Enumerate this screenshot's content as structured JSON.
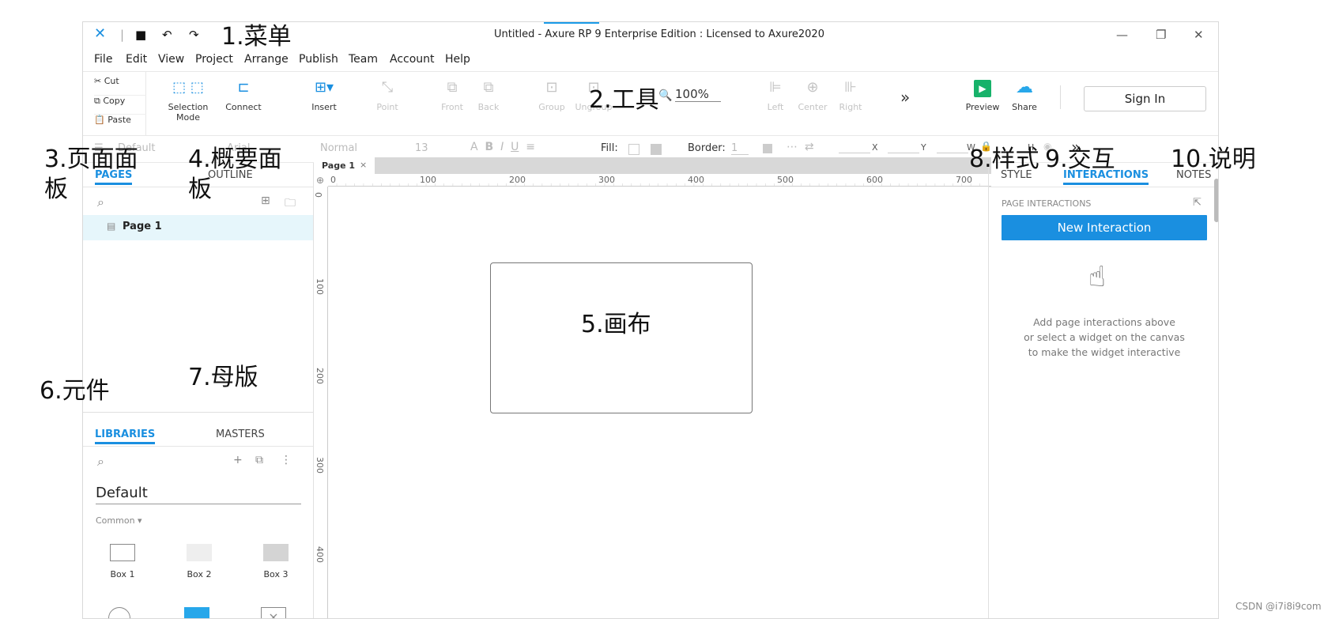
{
  "window": {
    "title": "Untitled - Axure RP 9 Enterprise Edition : Licensed to Axure2020"
  },
  "menu": [
    "File",
    "Edit",
    "View",
    "Project",
    "Arrange",
    "Publish",
    "Team",
    "Account",
    "Help"
  ],
  "clipboard": {
    "cut": "Cut",
    "copy": "Copy",
    "paste": "Paste"
  },
  "toolbar": {
    "selection_mode": "Selection Mode",
    "connect": "Connect",
    "insert": "Insert",
    "point": "Point",
    "front": "Front",
    "back": "Back",
    "group": "Group",
    "ungroup": "Ungroup",
    "zoom": "100%",
    "left": "Left",
    "center": "Center",
    "right": "Right",
    "preview": "Preview",
    "share": "Share",
    "sign_in": "Sign In"
  },
  "format": {
    "style": "Default",
    "font": "Arial",
    "weight": "Normal",
    "size": "13",
    "fill": "Fill:",
    "border": "Border:",
    "border_val": "1",
    "x": "X",
    "y": "Y",
    "w": "W",
    "h": "H"
  },
  "left_panel": {
    "tabs": {
      "pages": "PAGES",
      "outline": "OUTLINE"
    },
    "page_item": "Page 1",
    "lib_tabs": {
      "libraries": "LIBRARIES",
      "masters": "MASTERS"
    },
    "library_select": "Default",
    "group": "Common ▾",
    "items": [
      "Box 1",
      "Box 2",
      "Box 3"
    ]
  },
  "canvas": {
    "tab": "Page 1",
    "ruler_h": [
      "0",
      "100",
      "200",
      "300",
      "400",
      "500",
      "600",
      "700"
    ],
    "ruler_v": [
      "0",
      "100",
      "200",
      "300",
      "400"
    ]
  },
  "right_panel": {
    "tabs": {
      "style": "STYLE",
      "interactions": "INTERACTIONS",
      "notes": "NOTES"
    },
    "section": "PAGE INTERACTIONS",
    "new_button": "New Interaction",
    "help": [
      "Add page interactions above",
      "or select a widget on the canvas",
      "to make the widget interactive"
    ]
  },
  "annotations": {
    "menu": "1.菜单",
    "tools": "2.工具",
    "pages": "3.页面面",
    "pages2": "板",
    "outline": "4.概要面",
    "outline2": "板",
    "canvas": "5.画布",
    "widgets": "6.元件",
    "masters": "7.母版",
    "style": "8.样式",
    "interactions": "9.交互",
    "notes": "10.说明"
  },
  "watermark": "CSDN @i7i8i9com",
  "colors": {
    "accent": "#1a8fe0",
    "button": "#1a8fe0",
    "preview": "#17b26a",
    "share": "#27a7ea"
  }
}
